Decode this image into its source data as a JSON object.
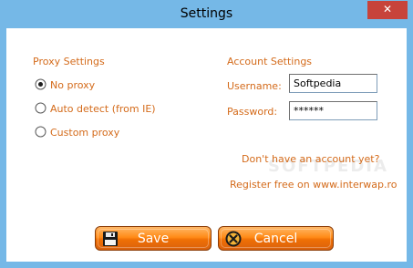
{
  "window": {
    "title": "Settings",
    "close_label": "✕"
  },
  "proxy": {
    "section_label": "Proxy Settings",
    "options": [
      {
        "label": "No proxy",
        "selected": true
      },
      {
        "label": "Auto detect (from IE)",
        "selected": false
      },
      {
        "label": "Custom proxy",
        "selected": false
      }
    ]
  },
  "account": {
    "section_label": "Account Settings",
    "username_label": "Username:",
    "username_value": "Softpedia",
    "password_label": "Password:",
    "password_value": "******",
    "no_account_text": "Don't have an account yet?",
    "register_text": "Register free on www.interwap.ro"
  },
  "watermark": "SOFTPEDIA",
  "buttons": {
    "save_label": "Save",
    "cancel_label": "Cancel"
  },
  "colors": {
    "accent_orange": "#d46b1b",
    "title_bar_blue": "#75b8e7",
    "close_red": "#c7433b",
    "button_orange": "#ff8b18"
  }
}
